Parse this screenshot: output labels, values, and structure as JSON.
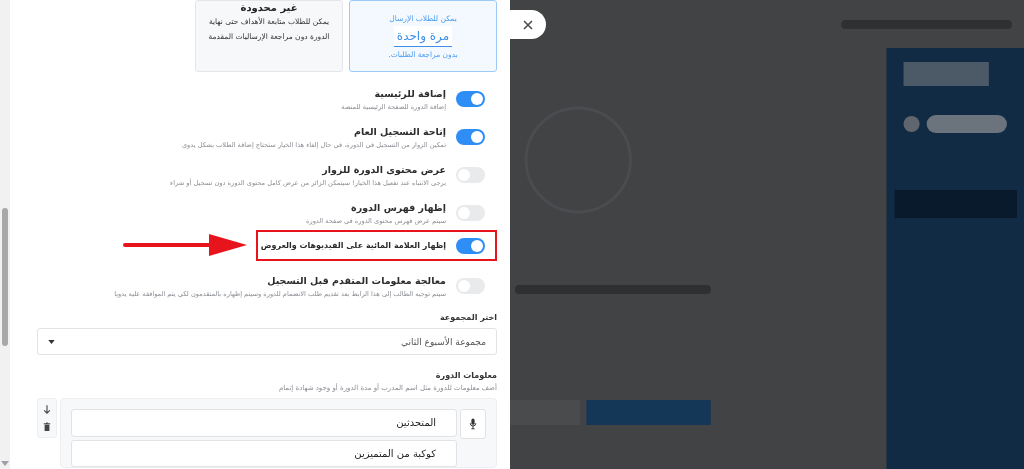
{
  "submission_modes": [
    {
      "selected": true,
      "lines": [
        {
          "kind": "text",
          "text": "يمكن للطلاب الإرسال"
        },
        {
          "kind": "highlight",
          "text": "مرة واحدة"
        },
        {
          "kind": "text",
          "text": "بدون مراجعة الطلبات."
        }
      ]
    },
    {
      "selected": false,
      "lines": [
        {
          "kind": "title",
          "text": "غير محدودة"
        },
        {
          "kind": "text",
          "text": "يمكن للطلاب متابعة الأهداف حتى نهاية الدورة دون مراجعة الإرساليات المقدمة"
        }
      ]
    }
  ],
  "toggles": [
    {
      "title": "إضافة للرئيسية",
      "description": "إضافة الدورة للصفحة الرئيسية للمنصة",
      "on": true,
      "highlighted": false
    },
    {
      "title": "إتاحة التسجيل العام",
      "description": "تمكين الزوار من التسجيل في الدورة، في حال إلغاء هذا الخيار ستحتاج إضافة الطلاب بشكل يدوي",
      "on": true,
      "highlighted": false
    },
    {
      "title": "عرض محتوى الدورة للزوار",
      "description": "يرجى الانتباه عند تفعيل هذا الخيار! سيتمكن الزائر من عرض كامل محتوى الدورة دون تسجيل أو شراء",
      "on": false,
      "highlighted": false
    },
    {
      "title": "إظهار فهرس الدورة",
      "description": "سيتم عرض فهرس محتوى الدورة في صفحة الدورة",
      "on": false,
      "highlighted": false
    },
    {
      "title": "إظهار العلامة المائية على الفيديوهات والعروض",
      "on": true,
      "highlighted": true
    },
    {
      "title": "معالجة معلومات المتقدم قبل التسجيل",
      "description": "سيتم توجيه الطالب إلى هذا الرابط بعد تقديم طلب الانضمام للدورة وسيتم إظهاره بالمتقدمون لكي يتم الموافقة عليه يدويا",
      "on": false,
      "highlighted": false
    }
  ],
  "group": {
    "label": "اختر المجموعة",
    "value": "مجموعة الأسبوع الثاني"
  },
  "course_info": {
    "title": "معلومات الدورة",
    "description": "أضف معلومات للدورة مثل اسم المدرب أو مدة الدورة أو وجود شهادة إتمام",
    "items": [
      {
        "title": "المتحدثين",
        "value": "كوكبة من المتميزين"
      }
    ]
  }
}
